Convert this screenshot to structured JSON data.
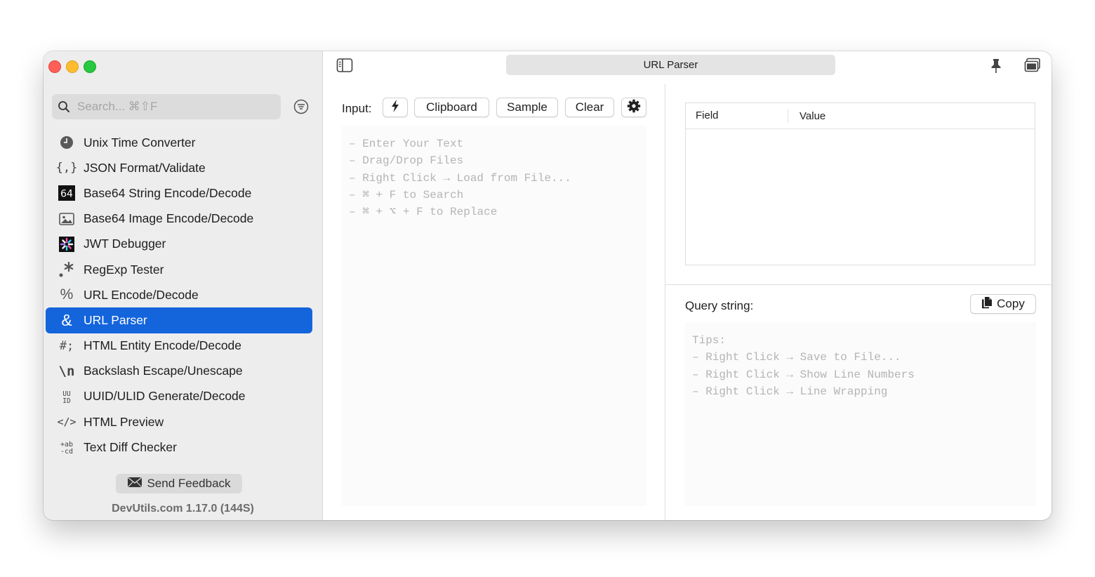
{
  "window": {
    "title": "URL Parser"
  },
  "sidebar": {
    "search_placeholder": "Search... ⌘⇧F",
    "items": [
      {
        "label": "Unix Time Converter",
        "icon": "clock-icon",
        "active": false
      },
      {
        "label": "JSON Format/Validate",
        "icon": "braces-icon",
        "active": false
      },
      {
        "label": "Base64 String Encode/Decode",
        "icon": "base64-icon",
        "active": false
      },
      {
        "label": "Base64 Image Encode/Decode",
        "icon": "image-icon",
        "active": false
      },
      {
        "label": "JWT Debugger",
        "icon": "jwt-icon",
        "active": false
      },
      {
        "label": "RegExp Tester",
        "icon": "regex-icon",
        "active": false
      },
      {
        "label": "URL Encode/Decode",
        "icon": "percent-icon",
        "active": false
      },
      {
        "label": "URL Parser",
        "icon": "ampersand-icon",
        "active": true
      },
      {
        "label": "HTML Entity Encode/Decode",
        "icon": "hash-semicolon-icon",
        "active": false
      },
      {
        "label": "Backslash Escape/Unescape",
        "icon": "backslash-n-icon",
        "active": false
      },
      {
        "label": "UUID/ULID Generate/Decode",
        "icon": "uuid-icon",
        "active": false
      },
      {
        "label": "HTML Preview",
        "icon": "code-tag-icon",
        "active": false
      },
      {
        "label": "Text Diff Checker",
        "icon": "diff-icon",
        "active": false
      }
    ],
    "feedback_label": "Send Feedback",
    "version": "DevUtils.com 1.17.0 (144S)"
  },
  "input": {
    "label": "Input:",
    "clipboard_label": "Clipboard",
    "sample_label": "Sample",
    "clear_label": "Clear",
    "placeholder_lines": [
      "– Enter Your Text",
      "– Drag/Drop Files",
      "– Right Click → Load from File...",
      "– ⌘ + F to Search",
      "– ⌘ + ⌥ + F to Replace"
    ]
  },
  "result": {
    "columns": [
      "Field",
      "Value"
    ],
    "rows": []
  },
  "query": {
    "label": "Query string:",
    "copy_label": "Copy",
    "tips_lines": [
      "Tips:",
      "– Right Click → Save to File...",
      "– Right Click → Show Line Numbers",
      "– Right Click → Line Wrapping"
    ]
  },
  "colors": {
    "accent": "#1464dc",
    "sidebar_bg": "#ededed",
    "traffic_red": "#fe5f57",
    "traffic_yellow": "#febc2e",
    "traffic_green": "#28c840"
  }
}
